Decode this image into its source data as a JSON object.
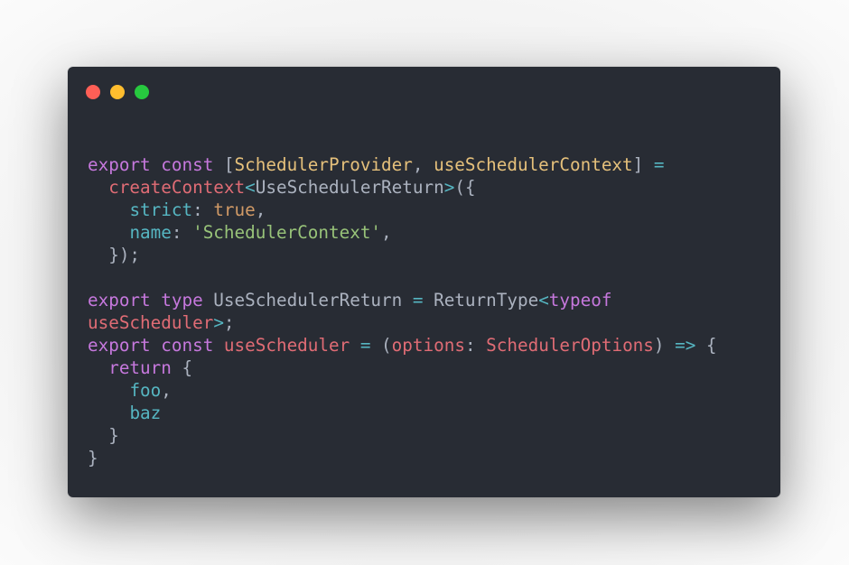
{
  "window": {
    "controls": [
      {
        "name": "close",
        "color": "#ff5f56"
      },
      {
        "name": "minimize",
        "color": "#ffbd2e"
      },
      {
        "name": "maximize",
        "color": "#27c93f"
      }
    ]
  },
  "code": {
    "language": "typescript",
    "lines": [
      [
        {
          "t": "export",
          "c": "kw"
        },
        {
          "t": " ",
          "c": "punc"
        },
        {
          "t": "const",
          "c": "kw"
        },
        {
          "t": " [",
          "c": "punc"
        },
        {
          "t": "SchedulerProvider",
          "c": "var"
        },
        {
          "t": ", ",
          "c": "punc"
        },
        {
          "t": "useSchedulerContext",
          "c": "var"
        },
        {
          "t": "] ",
          "c": "punc"
        },
        {
          "t": "=",
          "c": "op"
        }
      ],
      [
        {
          "t": "  ",
          "c": "punc"
        },
        {
          "t": "createContext",
          "c": "fn"
        },
        {
          "t": "<",
          "c": "op"
        },
        {
          "t": "UseSchedulerReturn",
          "c": "type"
        },
        {
          "t": ">",
          "c": "op"
        },
        {
          "t": "({",
          "c": "punc"
        }
      ],
      [
        {
          "t": "    ",
          "c": "punc"
        },
        {
          "t": "strict",
          "c": "prop"
        },
        {
          "t": ": ",
          "c": "punc"
        },
        {
          "t": "true",
          "c": "bool"
        },
        {
          "t": ",",
          "c": "punc"
        }
      ],
      [
        {
          "t": "    ",
          "c": "punc"
        },
        {
          "t": "name",
          "c": "prop"
        },
        {
          "t": ": ",
          "c": "punc"
        },
        {
          "t": "'SchedulerContext'",
          "c": "str"
        },
        {
          "t": ",",
          "c": "punc"
        }
      ],
      [
        {
          "t": "  });",
          "c": "punc"
        }
      ],
      [],
      [
        {
          "t": "export",
          "c": "kw"
        },
        {
          "t": " ",
          "c": "punc"
        },
        {
          "t": "type",
          "c": "kw"
        },
        {
          "t": " UseSchedulerReturn ",
          "c": "type"
        },
        {
          "t": "=",
          "c": "op"
        },
        {
          "t": " ReturnType",
          "c": "type"
        },
        {
          "t": "<",
          "c": "op"
        },
        {
          "t": "typeof",
          "c": "kw"
        }
      ],
      [
        {
          "t": "useScheduler",
          "c": "fn"
        },
        {
          "t": ">",
          "c": "op"
        },
        {
          "t": ";",
          "c": "punc"
        }
      ],
      [
        {
          "t": "export",
          "c": "kw"
        },
        {
          "t": " ",
          "c": "punc"
        },
        {
          "t": "const",
          "c": "kw"
        },
        {
          "t": " ",
          "c": "punc"
        },
        {
          "t": "useScheduler",
          "c": "fn"
        },
        {
          "t": " ",
          "c": "punc"
        },
        {
          "t": "=",
          "c": "op"
        },
        {
          "t": " (",
          "c": "punc"
        },
        {
          "t": "options",
          "c": "param"
        },
        {
          "t": ": ",
          "c": "punc"
        },
        {
          "t": "SchedulerOptions",
          "c": "param"
        },
        {
          "t": ") ",
          "c": "punc"
        },
        {
          "t": "=>",
          "c": "op"
        },
        {
          "t": " {",
          "c": "punc"
        }
      ],
      [
        {
          "t": "  ",
          "c": "punc"
        },
        {
          "t": "return",
          "c": "kw"
        },
        {
          "t": " {",
          "c": "punc"
        }
      ],
      [
        {
          "t": "    ",
          "c": "punc"
        },
        {
          "t": "foo",
          "c": "prop"
        },
        {
          "t": ",",
          "c": "punc"
        }
      ],
      [
        {
          "t": "    ",
          "c": "punc"
        },
        {
          "t": "baz",
          "c": "prop"
        }
      ],
      [
        {
          "t": "  }",
          "c": "punc"
        }
      ],
      [
        {
          "t": "}",
          "c": "punc"
        }
      ]
    ]
  }
}
